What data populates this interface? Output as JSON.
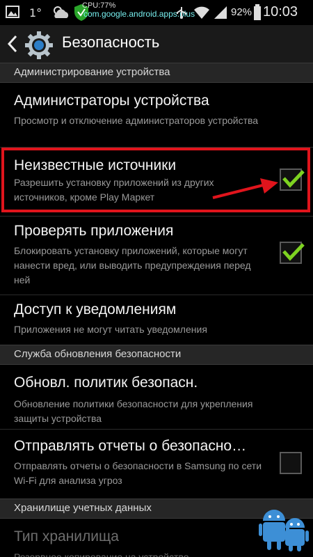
{
  "status_bar": {
    "cpu": "CPU:77%",
    "package": "com.google.android.apps.plus",
    "battery": "92%",
    "time": "10:03",
    "icons": [
      "image-icon",
      "temperature-icon",
      "weather-icon",
      "security-shield-icon",
      "usb-icon",
      "wifi-icon",
      "signal-icon",
      "battery-icon"
    ]
  },
  "action_bar": {
    "title": "Безопасность",
    "icons": [
      "back-chevron-icon",
      "settings-gear-icon"
    ]
  },
  "sections": [
    {
      "header": "Администрирование устройства",
      "items": [
        {
          "title": "Администраторы устройства",
          "subtitle": "Просмотр и отключение администраторов устройства"
        },
        {
          "title": "Неизвестные источники",
          "subtitle": "Разрешить установку приложений из других источников, кроме Play Маркет",
          "checked": true
        },
        {
          "title": "Проверять приложения",
          "subtitle": "Блокировать установку приложений, которые могут нанести вред, или выводить предупреждения перед ней",
          "checked": true
        },
        {
          "title": "Доступ к уведомлениям",
          "subtitle": "Приложения не могут читать уведомления"
        }
      ]
    },
    {
      "header": "Служба обновления безопасности",
      "items": [
        {
          "title": "Обновл. политик безопасн.",
          "subtitle": "Обновление политики безопасности для укрепления защиты устройства"
        },
        {
          "title": "Отправлять отчеты о безопасно…",
          "subtitle": "Отправлять отчеты о безопасности в Samsung по сети Wi-Fi для анализа угроз",
          "checked": false
        }
      ]
    },
    {
      "header": "Хранилище учетных данных",
      "items": [
        {
          "title": "Тип хранилища",
          "subtitle": "Резервное копирование на устройство",
          "disabled": true
        }
      ]
    }
  ],
  "colors": {
    "highlight": "#e0141c",
    "check": "#7ed321",
    "background": "#000000",
    "section_header": "#262626"
  },
  "watermark": "android-robots-logo"
}
